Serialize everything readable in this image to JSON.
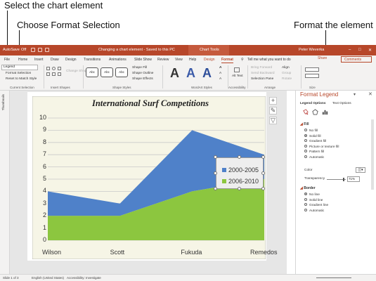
{
  "callouts": {
    "select": "Select the chart element",
    "choose": "Choose Format Selection",
    "format": "Format the element"
  },
  "titlebar": {
    "autosave": "AutoSave",
    "autosave_state": "Off",
    "doc_title": "Changing a chart element - Saved to this PC",
    "context": "Chart Tools",
    "user": "Peter Weverka"
  },
  "tabs": [
    "File",
    "Home",
    "Insert",
    "Draw",
    "Design",
    "Transitions",
    "Animations",
    "Slide Show",
    "Review",
    "View",
    "Help",
    "Design",
    "Format"
  ],
  "tell_me": "Tell me what you want to do",
  "share": "Share",
  "comments": "Comments",
  "ribbon": {
    "element_dropdown": "Legend",
    "format_selection": "Format Selection",
    "reset_style": "Reset to Match Style",
    "group_current_selection": "Current Selection",
    "change_shape": "Change Shape",
    "group_insert_shapes": "Insert Shapes",
    "shape_sample": "Abc",
    "shape_fill": "Shape Fill",
    "shape_outline": "Shape Outline",
    "shape_effects": "Shape Effects",
    "group_shape_styles": "Shape Styles",
    "wordart_letter": "A",
    "group_wordart": "WordArt Styles",
    "alt_text": "Alt Text",
    "group_accessibility": "Accessibility",
    "bring_forward": "Bring Forward",
    "send_backward": "Send Backward",
    "selection_pane": "Selection Pane",
    "align": "Align",
    "group": "Group",
    "rotate": "Rotate",
    "group_arrange": "Arrange",
    "group_size": "Size"
  },
  "thumbnails_label": "Thumbnails",
  "chart_data": {
    "type": "area",
    "title": "International Surf Competitions",
    "categories": [
      "Wilson",
      "Scott",
      "Fukuda",
      "Remedos"
    ],
    "series": [
      {
        "name": "2000-2005",
        "values": [
          4,
          3,
          9,
          7
        ],
        "color": "#4f81c9"
      },
      {
        "name": "2006-2010",
        "values": [
          2,
          2,
          4,
          5
        ],
        "color": "#8cc63f"
      }
    ],
    "ylim": [
      0,
      10
    ],
    "yticks": [
      "0",
      "1",
      "2",
      "3",
      "4",
      "5",
      "6",
      "7",
      "8",
      "9",
      "10"
    ],
    "grid": true,
    "legend_position": "right",
    "background": "#f6f5e6"
  },
  "pane": {
    "title": "Format Legend",
    "legend_options": "Legend Options",
    "text_options": "Text Options",
    "fill_header": "Fill",
    "fill_options": [
      "No fill",
      "Solid fill",
      "Gradient fill",
      "Picture or texture fill",
      "Pattern fill",
      "Automatic"
    ],
    "fill_selected": 1,
    "color_label": "Color",
    "transparency_label": "Transparency",
    "transparency_value": "71%",
    "border_header": "Border",
    "border_options": [
      "No line",
      "Solid line",
      "Gradient line",
      "Automatic"
    ],
    "border_selected": 0
  },
  "statusbar": {
    "slide": "Slide 1 of 3",
    "language": "English (United States)",
    "accessibility": "Accessibility: Investigate"
  }
}
